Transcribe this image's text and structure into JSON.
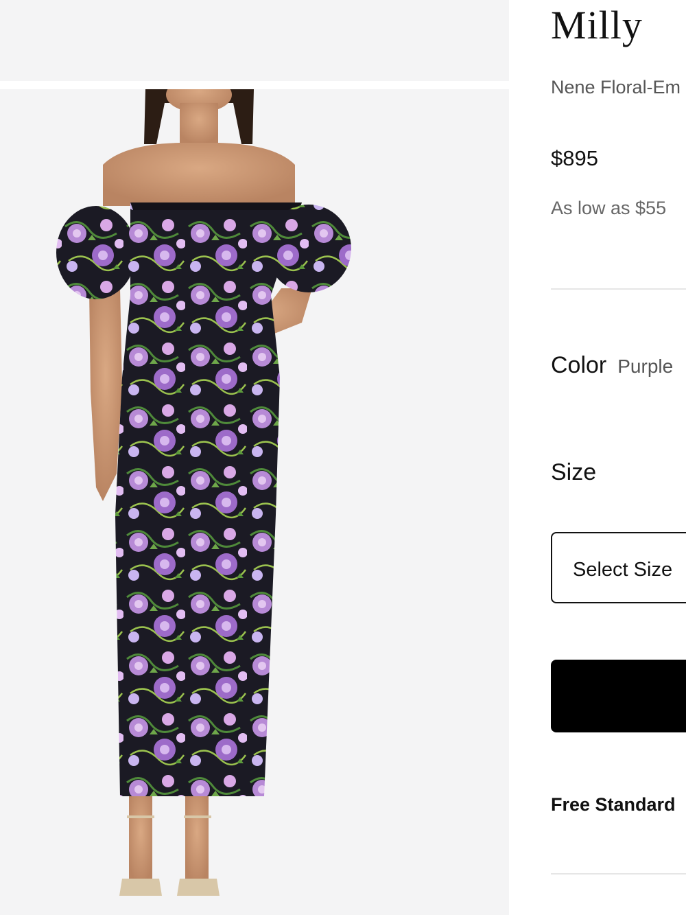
{
  "product": {
    "brand": "Milly",
    "name": "Nene Floral-Em",
    "price": "$895",
    "installments": "As low as $55"
  },
  "color": {
    "label": "Color",
    "value": "Purple"
  },
  "size": {
    "label": "Size",
    "placeholder": "Select Size"
  },
  "shipping": {
    "text": "Free Standard"
  },
  "gallery": {
    "image_alt": "Model wearing off-the-shoulder purple floral embroidered midi dress with puff sleeves",
    "background_color": "#f4f4f5"
  },
  "colors": {
    "button": "#000000",
    "divider": "#e6e6e6"
  }
}
